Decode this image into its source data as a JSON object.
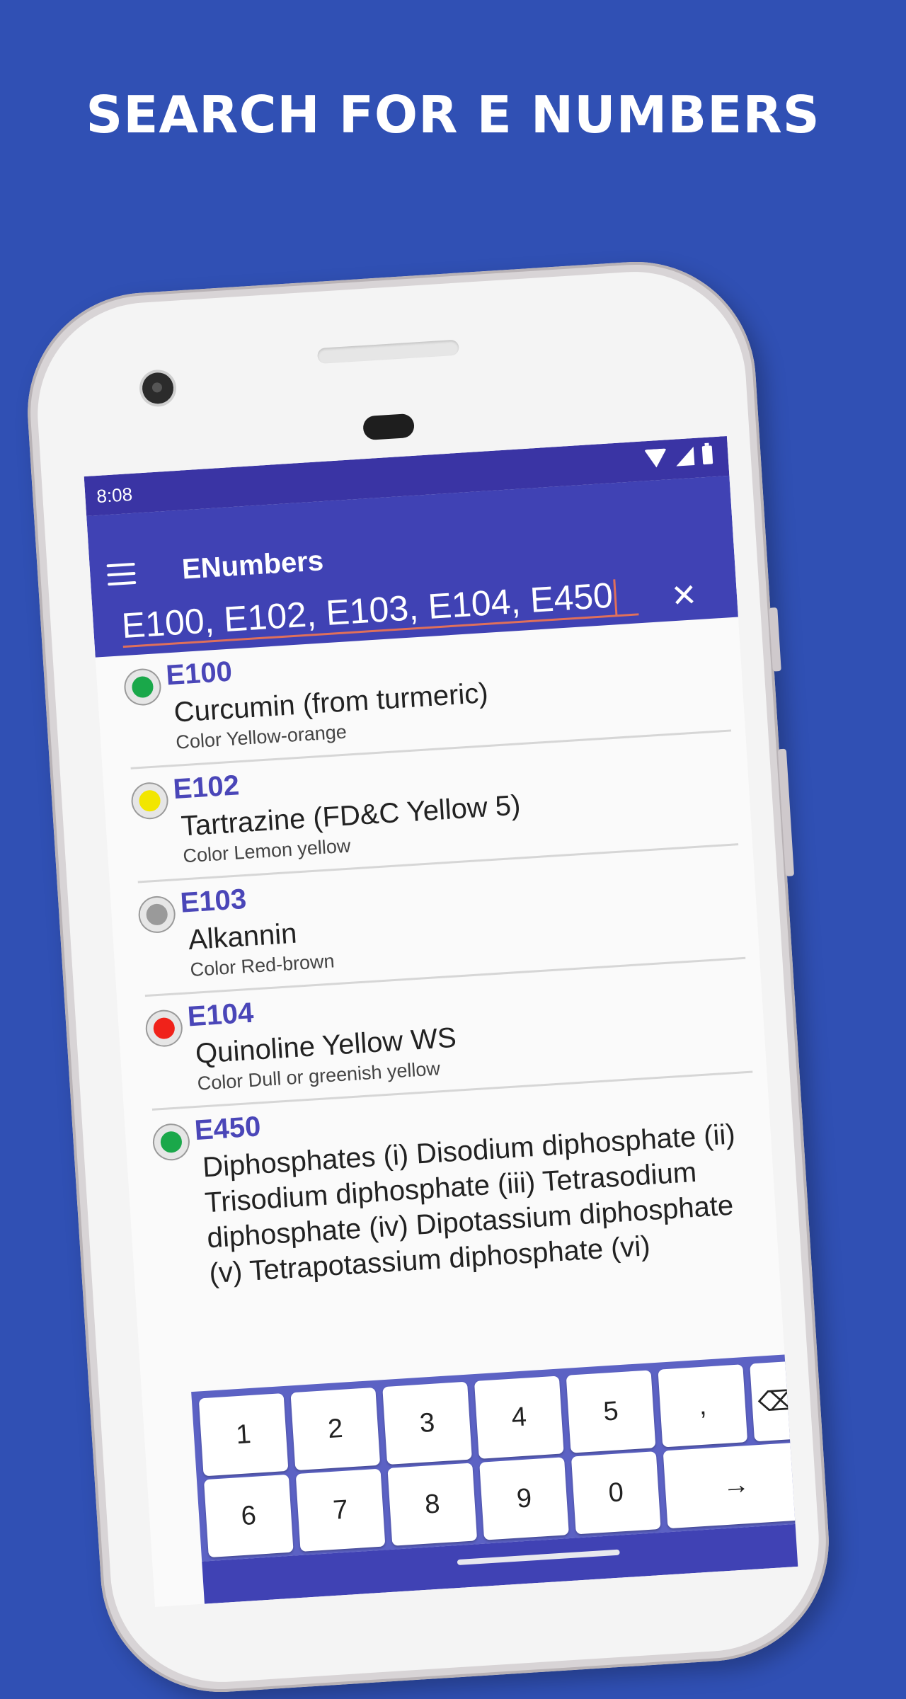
{
  "headline": "SEARCH FOR E NUMBERS",
  "status": {
    "time": "8:08"
  },
  "app": {
    "title": "ENumbers"
  },
  "search": {
    "value": "E100, E102, E103, E104, E450",
    "close_label": "✕"
  },
  "items": [
    {
      "code": "E100",
      "name": "Curcumin (from turmeric)",
      "desc": "Color Yellow-orange",
      "dot_color": "#1aa84a"
    },
    {
      "code": "E102",
      "name": "Tartrazine (FD&C Yellow 5)",
      "desc": "Color Lemon yellow",
      "dot_color": "#f2e600"
    },
    {
      "code": "E103",
      "name": "Alkannin",
      "desc": "Color Red-brown",
      "dot_color": "#9a9a9a"
    },
    {
      "code": "E104",
      "name": "Quinoline Yellow WS",
      "desc": "Color Dull or greenish yellow",
      "dot_color": "#f0221a"
    },
    {
      "code": "E450",
      "name": "Diphosphates (i) Disodium diphosphate (ii) Trisodium diphosphate (iii) Tetrasodium diphosphate (iv) Dipotassium diphosphate (v) Tetrapotassium diphosphate (vi)",
      "desc": "",
      "dot_color": "#1aa84a"
    }
  ],
  "keyboard": {
    "row1": [
      "1",
      "2",
      "3",
      "4",
      "5",
      ","
    ],
    "row2": [
      "6",
      "7",
      "8",
      "9",
      "0"
    ],
    "backspace_icon": "backspace-icon",
    "enter_icon": "arrow-right-icon",
    "backspace_glyph": "⌫",
    "enter_glyph": "→"
  }
}
